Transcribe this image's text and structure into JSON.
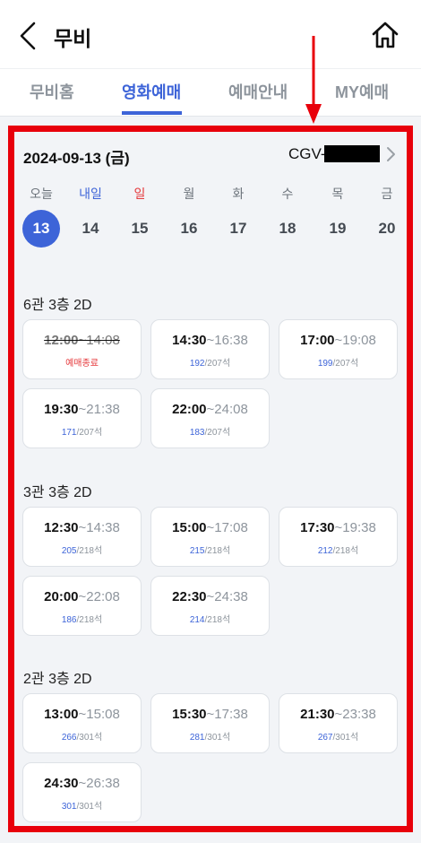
{
  "header": {
    "title": "무비"
  },
  "tabs": [
    {
      "label": "무비홈"
    },
    {
      "label": "영화예매"
    },
    {
      "label": "예매안내"
    },
    {
      "label": "MY예매"
    }
  ],
  "schedule": {
    "date": "2024-09-13 (금)",
    "cinema": "CGV-",
    "days": [
      {
        "label": "오늘",
        "num": "13"
      },
      {
        "label": "내일",
        "num": "14"
      },
      {
        "label": "일",
        "num": "15"
      },
      {
        "label": "월",
        "num": "16"
      },
      {
        "label": "화",
        "num": "17"
      },
      {
        "label": "수",
        "num": "18"
      },
      {
        "label": "목",
        "num": "19"
      },
      {
        "label": "금",
        "num": "20"
      }
    ]
  },
  "halls": [
    {
      "title": "6관 3층 2D",
      "showtimes": [
        {
          "start": "12:00",
          "end": "~14:08",
          "status": "예매종료"
        },
        {
          "start": "14:30",
          "end": "~16:38",
          "avail": "192",
          "total": "/207석"
        },
        {
          "start": "17:00",
          "end": "~19:08",
          "avail": "199",
          "total": "/207석"
        },
        {
          "start": "19:30",
          "end": "~21:38",
          "avail": "171",
          "total": "/207석"
        },
        {
          "start": "22:00",
          "end": "~24:08",
          "avail": "183",
          "total": "/207석"
        }
      ]
    },
    {
      "title": "3관 3층 2D",
      "showtimes": [
        {
          "start": "12:30",
          "end": "~14:38",
          "avail": "205",
          "total": "/218석"
        },
        {
          "start": "15:00",
          "end": "~17:08",
          "avail": "215",
          "total": "/218석"
        },
        {
          "start": "17:30",
          "end": "~19:38",
          "avail": "212",
          "total": "/218석"
        },
        {
          "start": "20:00",
          "end": "~22:08",
          "avail": "186",
          "total": "/218석"
        },
        {
          "start": "22:30",
          "end": "~24:38",
          "avail": "214",
          "total": "/218석"
        }
      ]
    },
    {
      "title": "2관 3층 2D",
      "showtimes": [
        {
          "start": "13:00",
          "end": "~15:08",
          "avail": "266",
          "total": "/301석"
        },
        {
          "start": "15:30",
          "end": "~17:38",
          "avail": "281",
          "total": "/301석"
        },
        {
          "start": "21:30",
          "end": "~23:38",
          "avail": "267",
          "total": "/301석"
        },
        {
          "start": "24:30",
          "end": "~26:38",
          "avail": "301",
          "total": "/301석"
        }
      ]
    }
  ],
  "colors": {
    "accent": "#3d64d8",
    "highlight": "#e8000b",
    "sunday": "#e5393c"
  },
  "icons": [
    "back-arrow-icon",
    "home-icon",
    "chevron-right-icon",
    "down-arrow-icon"
  ]
}
